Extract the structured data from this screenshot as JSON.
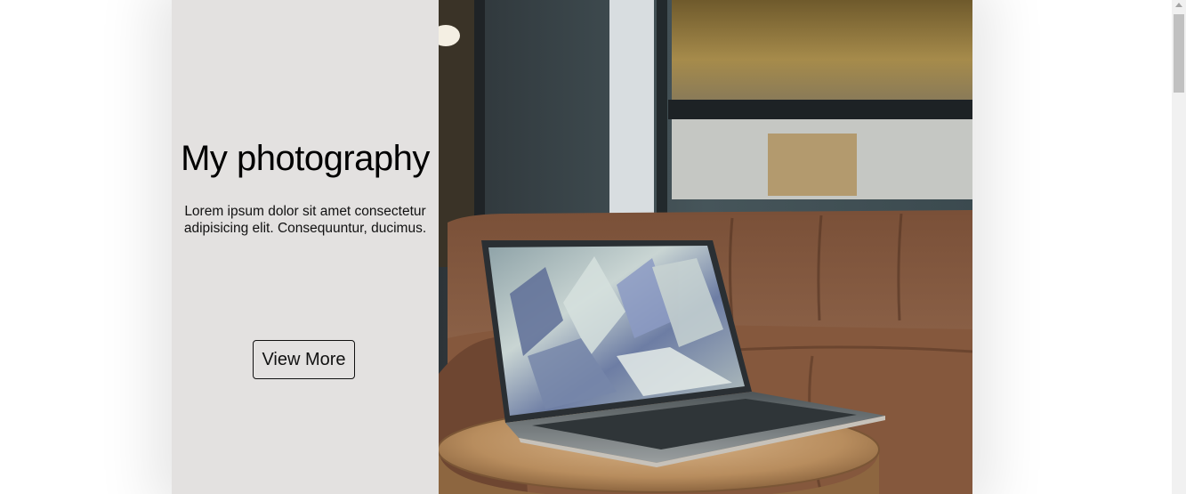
{
  "hero": {
    "title": "My photography",
    "description": "Lorem ipsum dolor sit amet consectetur adipisicing elit. Consequuntur, ducimus.",
    "button_label": "View More"
  },
  "photo": {
    "alt": "Laptop on a wooden side table in front of a brown leather sofa"
  },
  "colors": {
    "panel_background": "#e3e1e0",
    "page_background": "#ffffff"
  }
}
